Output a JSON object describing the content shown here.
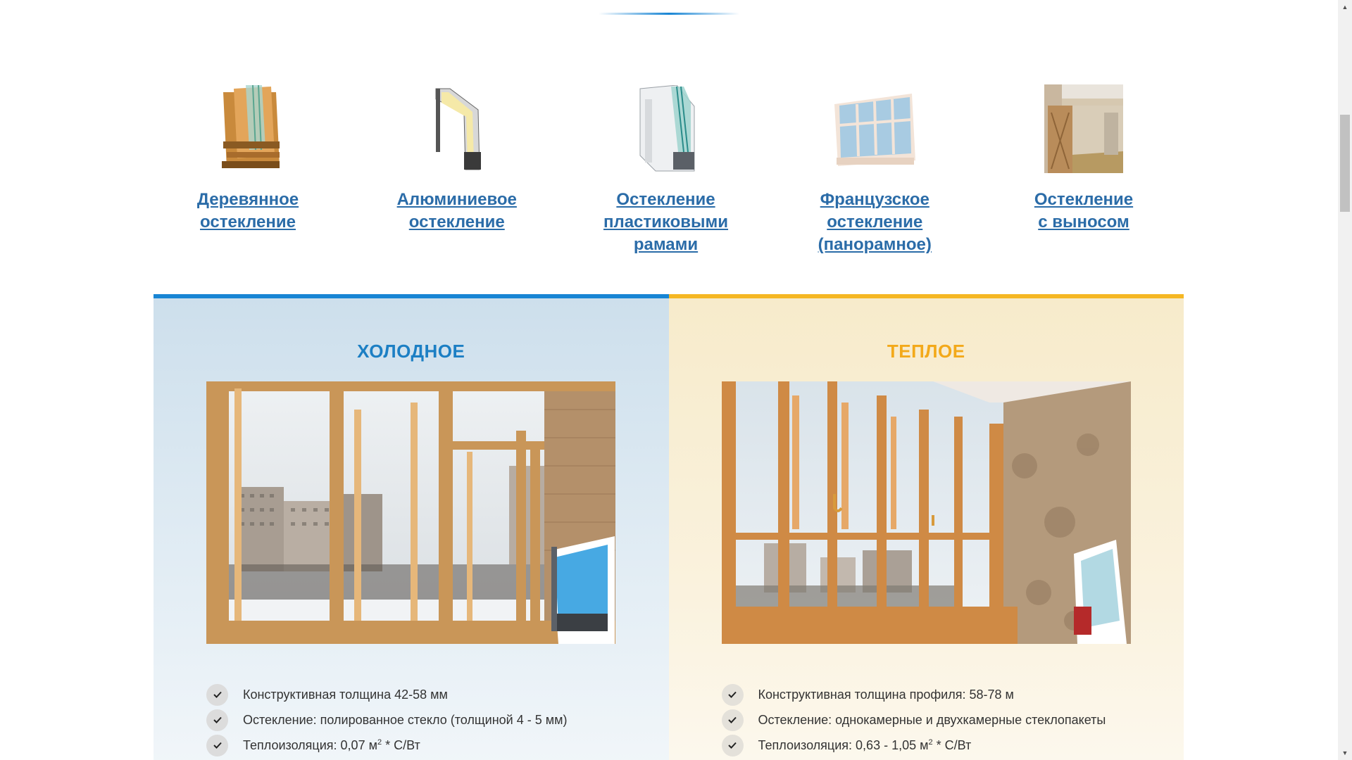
{
  "glazing_types": [
    {
      "label_lines": [
        "Деревянное",
        "остекление"
      ],
      "icon": "wooden-frame-icon"
    },
    {
      "label_lines": [
        "Алюминиевое",
        "остекление"
      ],
      "icon": "aluminum-frame-icon"
    },
    {
      "label_lines": [
        "Остекление",
        "пластиковыми",
        "рамами"
      ],
      "icon": "plastic-frame-icon"
    },
    {
      "label_lines": [
        "Французское",
        "остекление",
        "(панорамное)"
      ],
      "icon": "panoramic-balcony-icon"
    },
    {
      "label_lines": [
        "Остекление",
        "с выносом"
      ],
      "icon": "extended-balcony-icon"
    }
  ],
  "cold": {
    "title": "ХОЛОДНОЕ",
    "photo": "cold-balcony-photo",
    "features": [
      {
        "text": "Конструктивная толщина 42-58 мм",
        "sup": "",
        "after": ""
      },
      {
        "text": "Остекление: полированное стекло (толщиной 4 - 5 мм)",
        "sup": "",
        "after": ""
      },
      {
        "text": "Теплоизоляция: 0,07 м",
        "sup": "2",
        "after": " * С/Вт"
      }
    ]
  },
  "warm": {
    "title": "ТЕПЛОЕ",
    "photo": "warm-balcony-photo",
    "features": [
      {
        "text": "Конструктивная толщина профиля: 58-78 м",
        "sup": "",
        "after": ""
      },
      {
        "text": "Остекление: однокамерные и двухкамерные стеклопакеты",
        "sup": "",
        "after": ""
      },
      {
        "text": "Теплоизоляция: 0,63 - 1,05 м",
        "sup": "2",
        "after": " * С/Вт"
      }
    ]
  },
  "colors": {
    "link": "#2b6ca8",
    "cold_accent": "#1885d4",
    "warm_accent": "#f5b723",
    "cold_title": "#1c7fc4",
    "warm_title": "#f3a91a"
  }
}
